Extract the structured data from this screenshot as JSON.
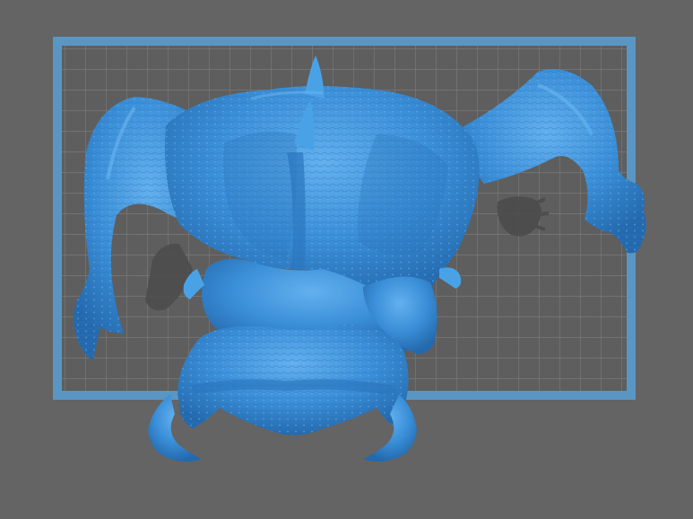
{
  "app": {
    "view": "slicer-3d-viewport"
  },
  "scene": {
    "background_color": "#646464",
    "build_plate": {
      "frame_color": "#5a96c3",
      "grid_fill_color": "#5e5e5e",
      "grid_line_color": "#787878"
    },
    "model": {
      "name": "creature-miniature",
      "base_color": "#3a8fd8",
      "shade_color": "#2b76bd",
      "highlight_color": "#63b0ee"
    },
    "shadow_color": "#4c4c4c"
  }
}
